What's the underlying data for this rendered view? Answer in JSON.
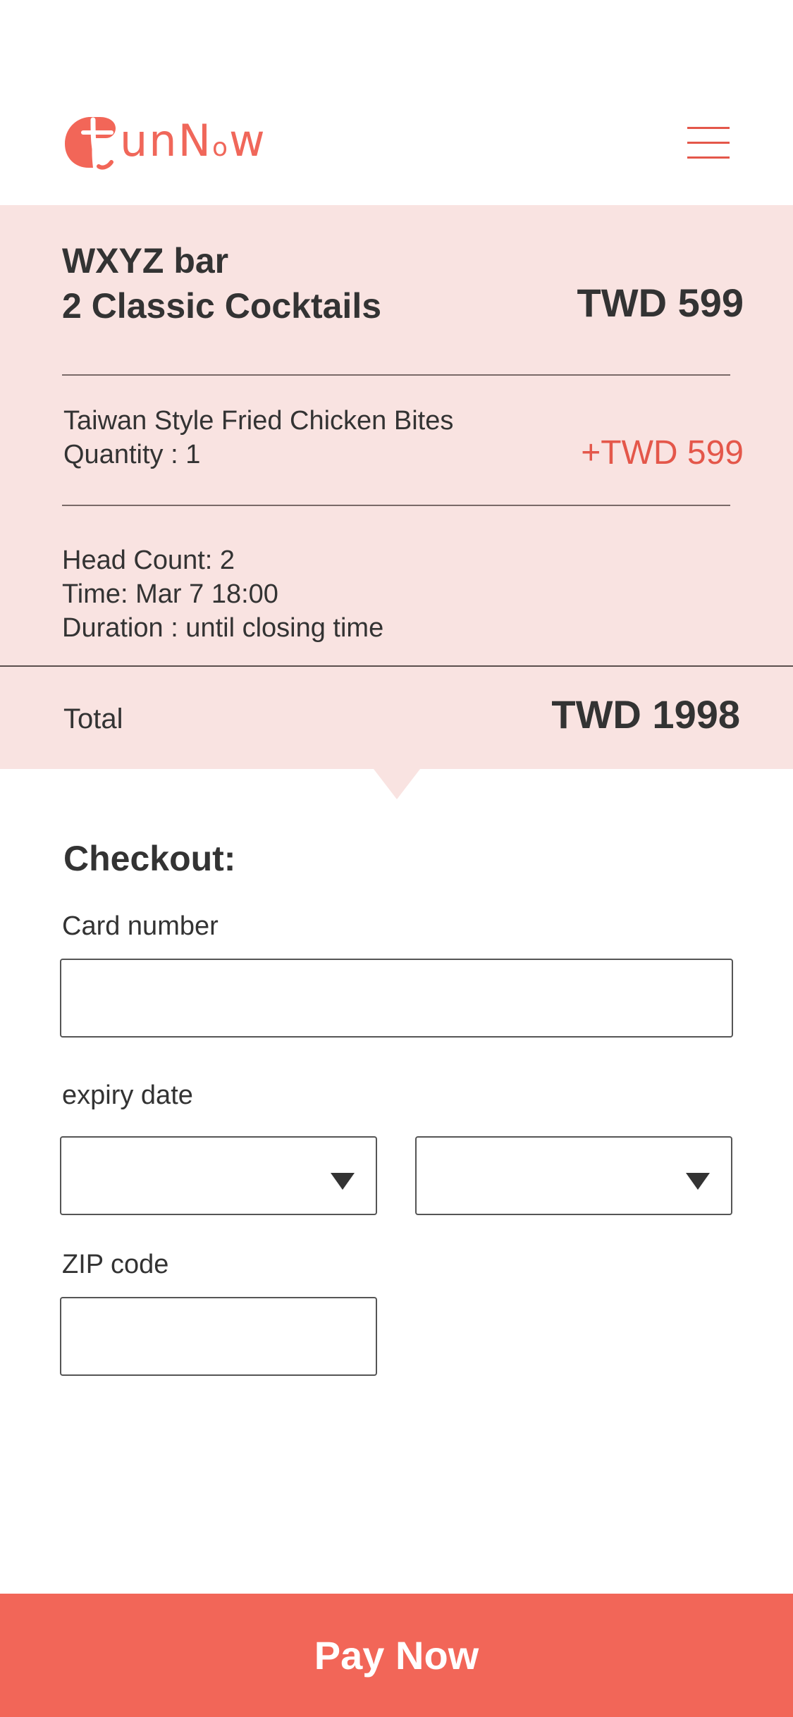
{
  "brand": {
    "logo_text": "unN",
    "logo_small_o": "o",
    "logo_tail": "w",
    "accent_color": "#f26658",
    "panel_color": "#f9e3e1"
  },
  "header": {
    "menu_icon": "hamburger-menu-icon"
  },
  "order": {
    "venue": "WXYZ bar",
    "deal": "2 Classic Cocktails",
    "deal_price": "TWD 599",
    "addon": {
      "name": "Taiwan Style Fried Chicken Bites",
      "quantity": "Quantity : 1",
      "price": "+TWD 599"
    },
    "details": {
      "head_count": "Head Count: 2",
      "time": "Time: Mar 7 18:00",
      "duration": "Duration : until closing time"
    },
    "total_label": "Total",
    "total_value": "TWD 1998"
  },
  "checkout": {
    "title": "Checkout:",
    "card_label": "Card number",
    "card_value": "",
    "expiry_label": "expiry date",
    "expiry_month": "",
    "expiry_year": "",
    "zip_label": "ZIP code",
    "zip_value": ""
  },
  "pay_button": "Pay Now"
}
